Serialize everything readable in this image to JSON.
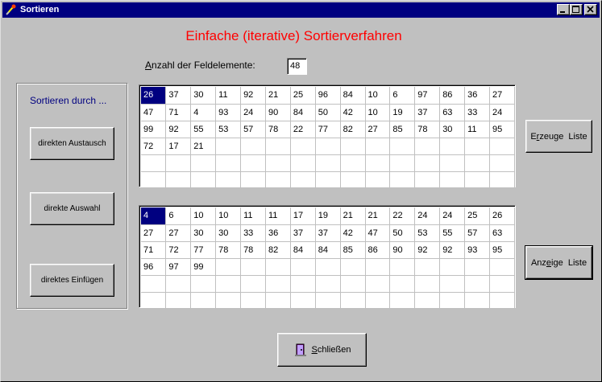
{
  "window": {
    "title": "Sortieren"
  },
  "heading": "Einfache (iterative) Sortierverfahren",
  "count": {
    "label_prefix": "A",
    "label_rest": "nzahl der Feldelemente:",
    "value": "48"
  },
  "sort_group": {
    "label": "Sortieren durch ...",
    "buttons": [
      "direkten Austausch",
      "direkte Auswahl",
      "direktes Einfügen"
    ]
  },
  "generate_button": {
    "pre": "E",
    "accel": "r",
    "post": "zeuge  Liste"
  },
  "display_button": {
    "pre": "Anz",
    "accel": "e",
    "post": "ige  Liste"
  },
  "close_button": {
    "accel": "S",
    "post": "chließen"
  },
  "grid_unsorted": [
    [
      "26",
      "37",
      "30",
      "11",
      "92",
      "21",
      "25",
      "96",
      "84",
      "10",
      "6",
      "97",
      "86",
      "36",
      "27"
    ],
    [
      "47",
      "71",
      "4",
      "93",
      "24",
      "90",
      "84",
      "50",
      "42",
      "10",
      "19",
      "37",
      "63",
      "33",
      "24"
    ],
    [
      "99",
      "92",
      "55",
      "53",
      "57",
      "78",
      "22",
      "77",
      "82",
      "27",
      "85",
      "78",
      "30",
      "11",
      "95"
    ],
    [
      "72",
      "17",
      "21",
      "",
      "",
      "",
      "",
      "",
      "",
      "",
      "",
      "",
      "",
      "",
      ""
    ],
    [
      "",
      "",
      "",
      "",
      "",
      "",
      "",
      "",
      "",
      "",
      "",
      "",
      "",
      "",
      ""
    ],
    [
      "",
      "",
      "",
      "",
      "",
      "",
      "",
      "",
      "",
      "",
      "",
      "",
      "",
      "",
      ""
    ]
  ],
  "grid_sorted": [
    [
      "4",
      "6",
      "10",
      "10",
      "11",
      "11",
      "17",
      "19",
      "21",
      "21",
      "22",
      "24",
      "24",
      "25",
      "26"
    ],
    [
      "27",
      "27",
      "30",
      "30",
      "33",
      "36",
      "37",
      "37",
      "42",
      "47",
      "50",
      "53",
      "55",
      "57",
      "63"
    ],
    [
      "71",
      "72",
      "77",
      "78",
      "78",
      "82",
      "84",
      "84",
      "85",
      "86",
      "90",
      "92",
      "92",
      "93",
      "95"
    ],
    [
      "96",
      "97",
      "99",
      "",
      "",
      "",
      "",
      "",
      "",
      "",
      "",
      "",
      "",
      "",
      ""
    ],
    [
      "",
      "",
      "",
      "",
      "",
      "",
      "",
      "",
      "",
      "",
      "",
      "",
      "",
      "",
      ""
    ],
    [
      "",
      "",
      "",
      "",
      "",
      "",
      "",
      "",
      "",
      "",
      "",
      "",
      "",
      "",
      ""
    ]
  ]
}
